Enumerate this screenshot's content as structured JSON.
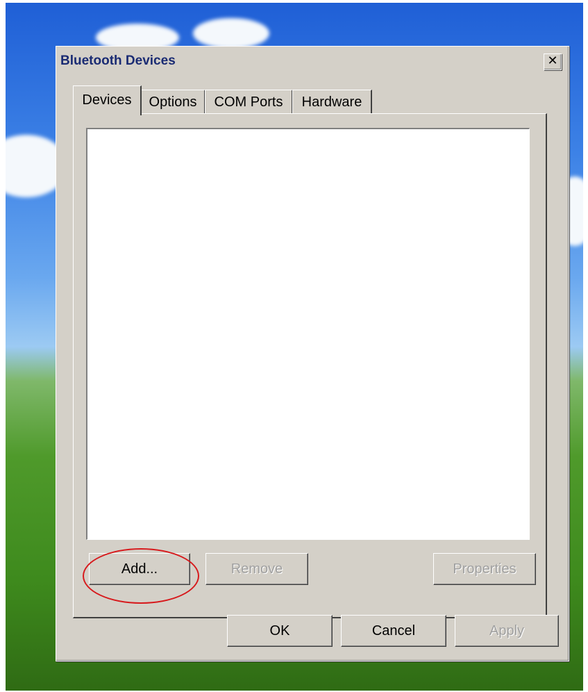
{
  "window": {
    "title": "Bluetooth Devices",
    "close_glyph": "✕"
  },
  "tabs": [
    {
      "label": "Devices",
      "active": true
    },
    {
      "label": "Options",
      "active": false
    },
    {
      "label": "COM Ports",
      "active": false
    },
    {
      "label": "Hardware",
      "active": false
    }
  ],
  "panel_buttons": {
    "add": "Add...",
    "remove": "Remove",
    "properties": "Properties"
  },
  "dialog_buttons": {
    "ok": "OK",
    "cancel": "Cancel",
    "apply": "Apply"
  },
  "colors": {
    "dialog_face": "#d4d0c8",
    "title_text": "#1a2b73",
    "annotation_circle": "#d7191c"
  }
}
